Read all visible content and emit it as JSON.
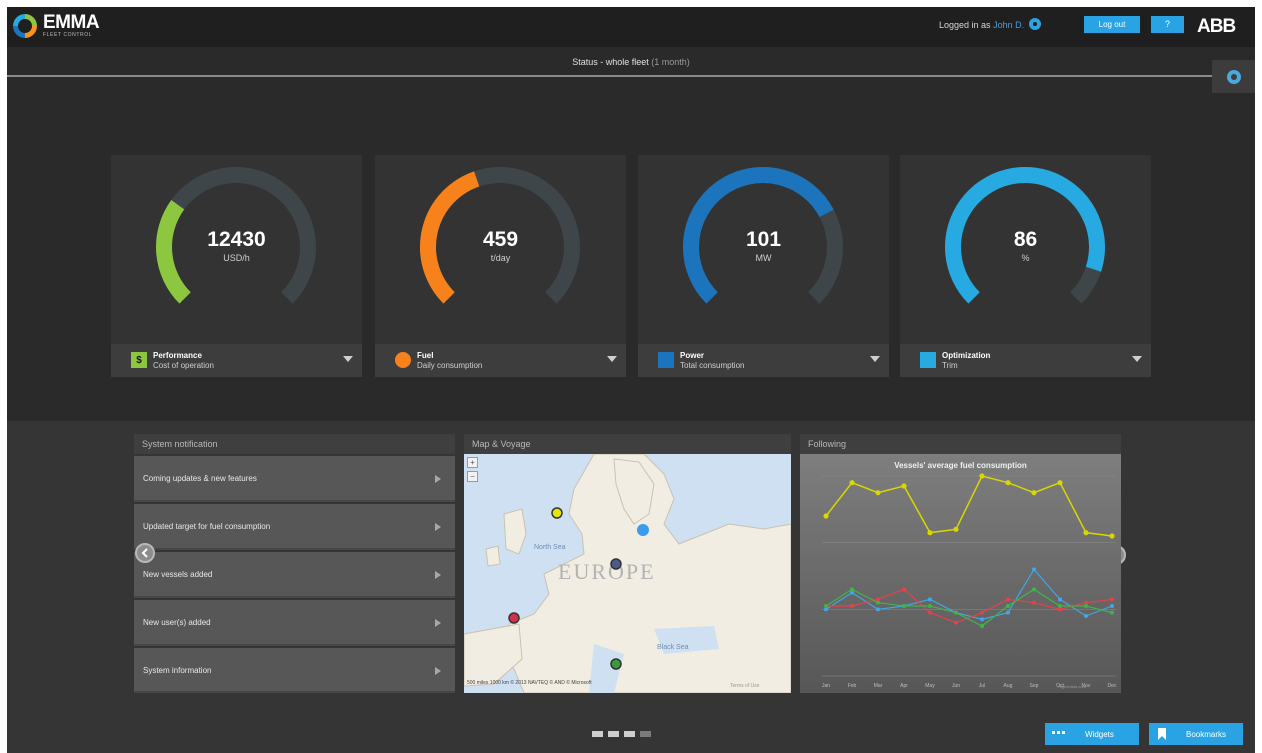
{
  "app": {
    "name": "EMMA",
    "tagline": "FLEET CONTROL",
    "brand": "ABB"
  },
  "header": {
    "logged_in_prefix": "Logged in as",
    "user": "John D.",
    "logout_label": "Log out",
    "help_label": "?"
  },
  "status": {
    "title": "Status - whole fleet",
    "period": "(1 month)"
  },
  "gauges": [
    {
      "value": "12430",
      "unit": "USD/h",
      "fraction": 0.3,
      "color": "#8dc63f",
      "title": "Performance",
      "subtitle": "Cost of operation",
      "icon": "dollar-icon",
      "icon_glyph": "$"
    },
    {
      "value": "459",
      "unit": "t/day",
      "fraction": 0.43,
      "color": "#f7821b",
      "title": "Fuel",
      "subtitle": "Daily consumption",
      "icon": "fuel-icon",
      "icon_glyph": ""
    },
    {
      "value": "101",
      "unit": "MW",
      "fraction": 0.73,
      "color": "#1c75bc",
      "title": "Power",
      "subtitle": "Total consumption",
      "icon": "power-icon",
      "icon_glyph": ""
    },
    {
      "value": "86",
      "unit": "%",
      "fraction": 0.9,
      "color": "#27aae1",
      "title": "Optimization",
      "subtitle": "Trim",
      "icon": "trim-icon",
      "icon_glyph": ""
    }
  ],
  "notifications": {
    "title": "System notification",
    "items": [
      "Coming updates & new features",
      "Updated target for fuel consumption",
      "New vessels added",
      "New user(s) added",
      "System information"
    ]
  },
  "map": {
    "title": "Map & Voyage",
    "region_label": "EUROPE",
    "sea_north": "North Sea",
    "sea_black": "Black Sea",
    "credits": "500 miles    1000 km   © 2013 NAVTEQ   © AND   © Microsoft",
    "terms": "Terms of Use",
    "markers": [
      {
        "color": "#e6e600"
      },
      {
        "color": "#3a9bef"
      },
      {
        "color": "#4a5a8a"
      },
      {
        "color": "#d0304a"
      },
      {
        "color": "#3c9a3c"
      }
    ]
  },
  "following": {
    "title": "Following",
    "credit": "Highcharts.com"
  },
  "chart_data": {
    "type": "line",
    "title": "Vessels' average fuel consumption",
    "categories": [
      "Jan",
      "Feb",
      "Mar",
      "Apr",
      "May",
      "Jun",
      "Jul",
      "Aug",
      "Sep",
      "Oct",
      "Nov",
      "Dec"
    ],
    "yticks": [
      "",
      "",
      "",
      ""
    ],
    "ylim": [
      0,
      30
    ],
    "series": [
      {
        "color": "#d8d800",
        "values": [
          24,
          29,
          27.5,
          28.5,
          21.5,
          22,
          30,
          29,
          27.5,
          29,
          21.5,
          21
        ]
      },
      {
        "color": "#3fa8e6",
        "values": [
          10,
          12.5,
          10,
          10.5,
          11.5,
          9.5,
          8.5,
          9.5,
          16,
          11.5,
          9,
          10.5
        ]
      },
      {
        "color": "#e8404a",
        "values": [
          10.5,
          10.5,
          11.5,
          13,
          9.5,
          8,
          9.5,
          11.5,
          11,
          10,
          11,
          11.5
        ]
      },
      {
        "color": "#41b34a",
        "values": [
          10.5,
          13,
          11,
          10.5,
          10.5,
          9.5,
          7.5,
          10.5,
          13,
          10.5,
          10.5,
          9.5
        ]
      }
    ]
  },
  "footer": {
    "widgets_label": "Widgets",
    "bookmarks_label": "Bookmarks",
    "pages": 4,
    "active_page": 1
  }
}
